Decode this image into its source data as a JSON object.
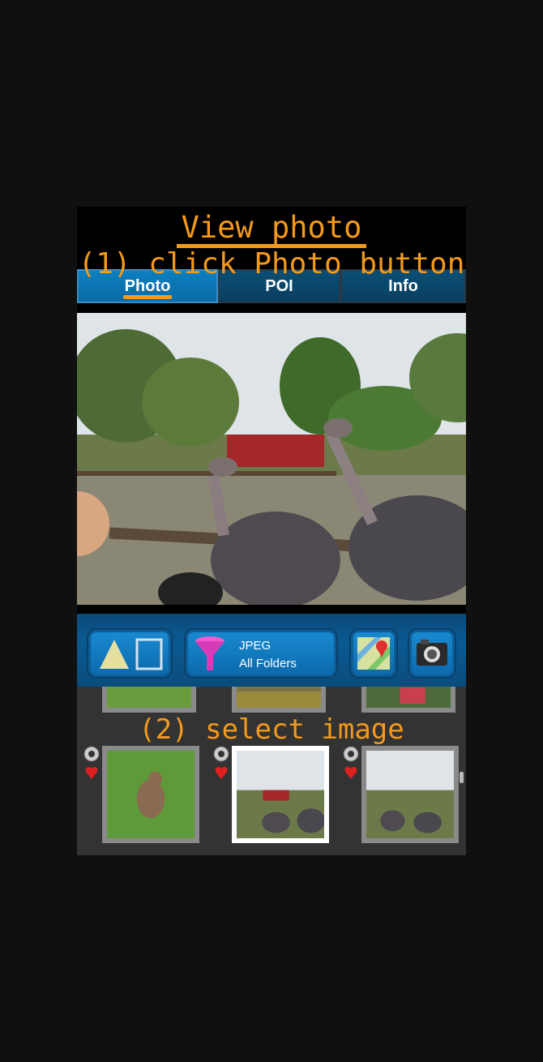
{
  "annotations": {
    "title": "View photo",
    "step1": "(1) click Photo button",
    "step2": "(2) select image"
  },
  "tabs": [
    {
      "label": "Photo",
      "active": true
    },
    {
      "label": "POI",
      "active": false
    },
    {
      "label": "Info",
      "active": false
    }
  ],
  "toolbar": {
    "filter_type": "JPEG",
    "filter_scope": "All Folders"
  },
  "colors": {
    "annotation": "#f39a1c",
    "tab_active": "#0d7fc0",
    "tab_inactive": "#0b4e74",
    "toolbar": "#0a5a92"
  },
  "icons": [
    "navigation-arrow-icon",
    "funnel-icon",
    "map-icon",
    "camera-icon",
    "camera-small-icon",
    "heart-pin-icon"
  ]
}
